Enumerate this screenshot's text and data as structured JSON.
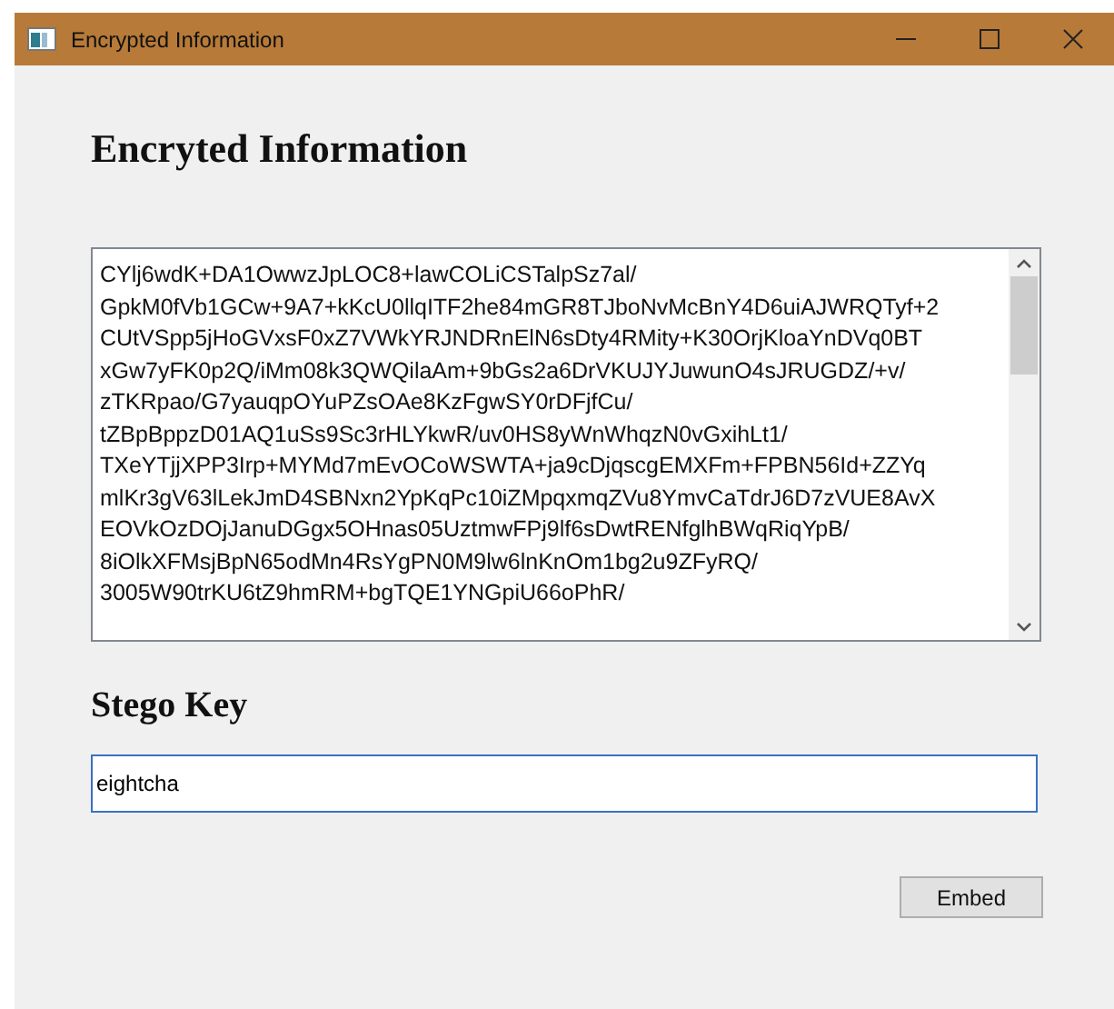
{
  "window": {
    "title": "Encrypted Information"
  },
  "heading": "Encryted Information",
  "encrypted_text": {
    "lines": [
      "CYlj6wdK+DA1OwwzJpLOC8+lawCOLiCSTalpSz7al/",
      "GpkM0fVb1GCw+9A7+kKcU0llqITF2he84mGR8TJboNvMcBnY4D6uiAJWRQTyf+2",
      "CUtVSpp5jHoGVxsF0xZ7VWkYRJNDRnElN6sDty4RMity+K30OrjKloaYnDVq0BT",
      "xGw7yFK0p2Q/iMm08k3QWQilaAm+9bGs2a6DrVKUJYJuwunO4sJRUGDZ/+v/",
      "zTKRpao/G7yauqpOYuPZsOAe8KzFgwSY0rDFjfCu/",
      "tZBpBppzD01AQ1uSs9Sc3rHLYkwR/uv0HS8yWnWhqzN0vGxihLt1/",
      "TXeYTjjXPP3Irp+MYMd7mEvOCoWSWTA+ja9cDjqscgEMXFm+FPBN56Id+ZZYq",
      "mlKr3gV63lLekJmD4SBNxn2YpKqPc10iZMpqxmqZVu8YmvCaTdrJ6D7zVUE8AvX",
      "EOVkOzDOjJanuDGgx5OHnas05UztmwFPj9lf6sDwtRENfglhBWqRiqYpB/",
      "8iOlkXFMsjBpN65odMn4RsYgPN0M9lw6lnKnOm1bg2u9ZFyRQ/",
      "3005W90trKU6tZ9hmRM+bgTQE1YNGpiU66oPhR/"
    ]
  },
  "stego_key": {
    "label": "Stego Key",
    "value": "eightcha"
  },
  "buttons": [
    {
      "label": "Embed"
    }
  ]
}
